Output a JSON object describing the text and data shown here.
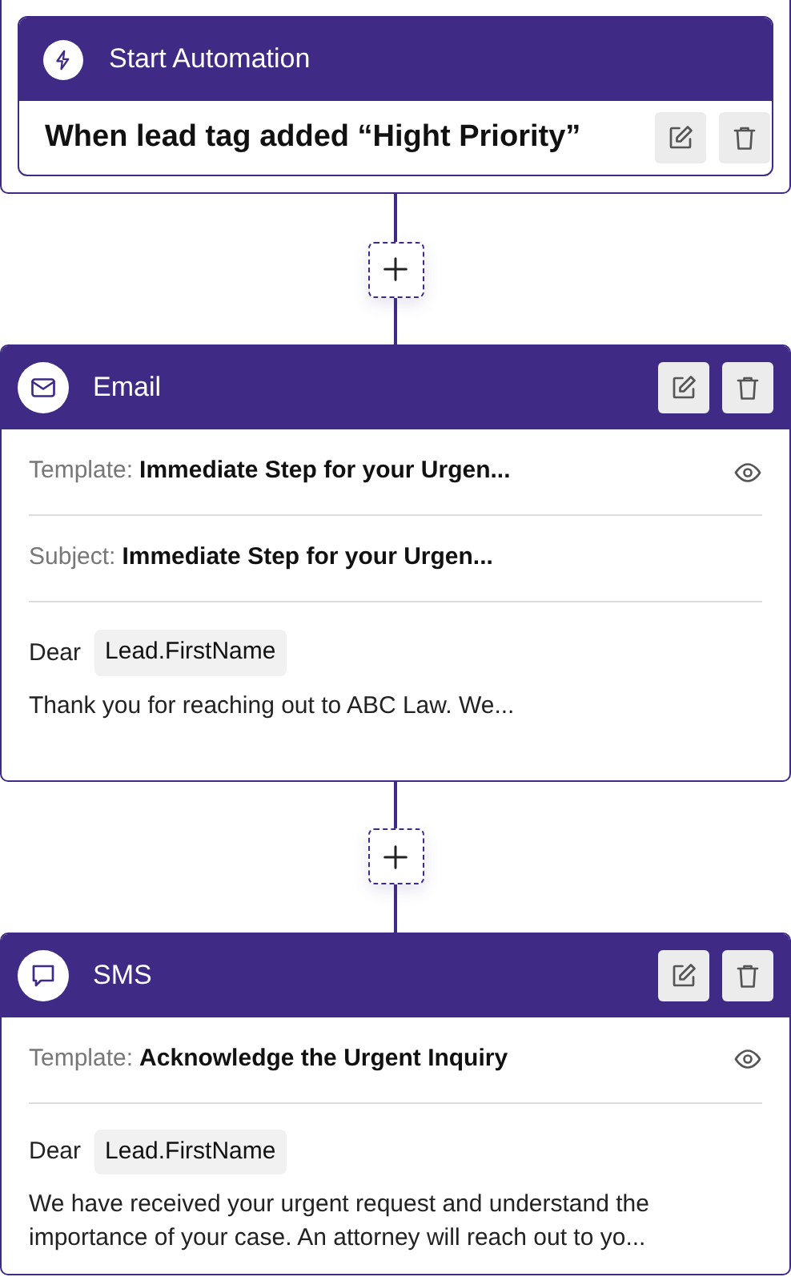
{
  "trigger": {
    "title": "Start Automation",
    "condition": "When lead tag added “Hight Priority”"
  },
  "steps": [
    {
      "kind": "email",
      "title": "Email",
      "fields": [
        {
          "label": "Template:",
          "value": "Immediate Step for your Urgen...",
          "preview": true
        },
        {
          "label": "Subject:",
          "value": "Immediate Step for your Urgen...",
          "preview": false
        }
      ],
      "greeting": "Dear",
      "token": "Lead.FirstName",
      "message": "Thank you for reaching out to ABC Law. We..."
    },
    {
      "kind": "sms",
      "title": "SMS",
      "fields": [
        {
          "label": "Template:",
          "value": "Acknowledge the Urgent Inquiry",
          "preview": true
        }
      ],
      "greeting": "Dear",
      "token": "Lead.FirstName",
      "message": "We have received your urgent request and understand the importance of your case. An attorney will reach out to yo..."
    }
  ]
}
